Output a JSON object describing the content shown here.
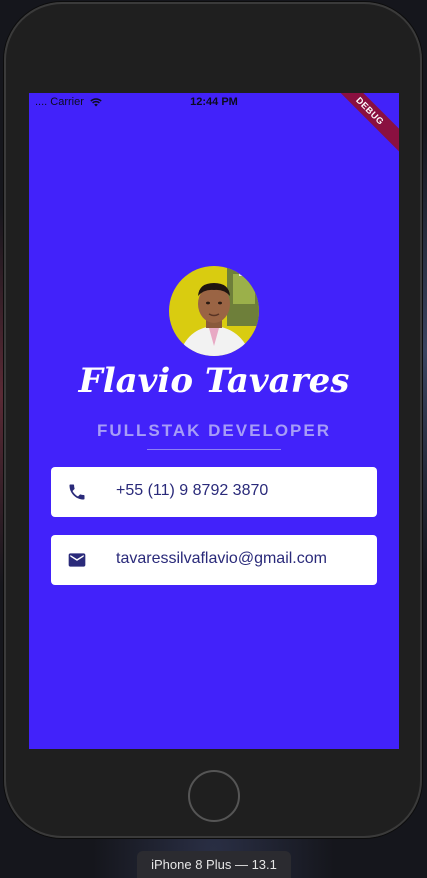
{
  "status_bar": {
    "carrier": ".... Carrier",
    "time": "12:44 PM",
    "debug_banner": "DEBUG"
  },
  "profile": {
    "name": "Flavio Tavares",
    "title": "FULLSTAK DEVELOPER"
  },
  "contacts": [
    {
      "icon": "phone-icon",
      "value": "+55 (11) 9 8792 3870"
    },
    {
      "icon": "mail-icon",
      "value": "tavaressilvaflavio@gmail.com"
    }
  ],
  "simulator": {
    "device_label": "iPhone 8 Plus — 13.1"
  },
  "colors": {
    "background": "#4222fa",
    "card": "#ffffff",
    "icon": "#2a2a7a",
    "subtitle": "#a79df7"
  }
}
